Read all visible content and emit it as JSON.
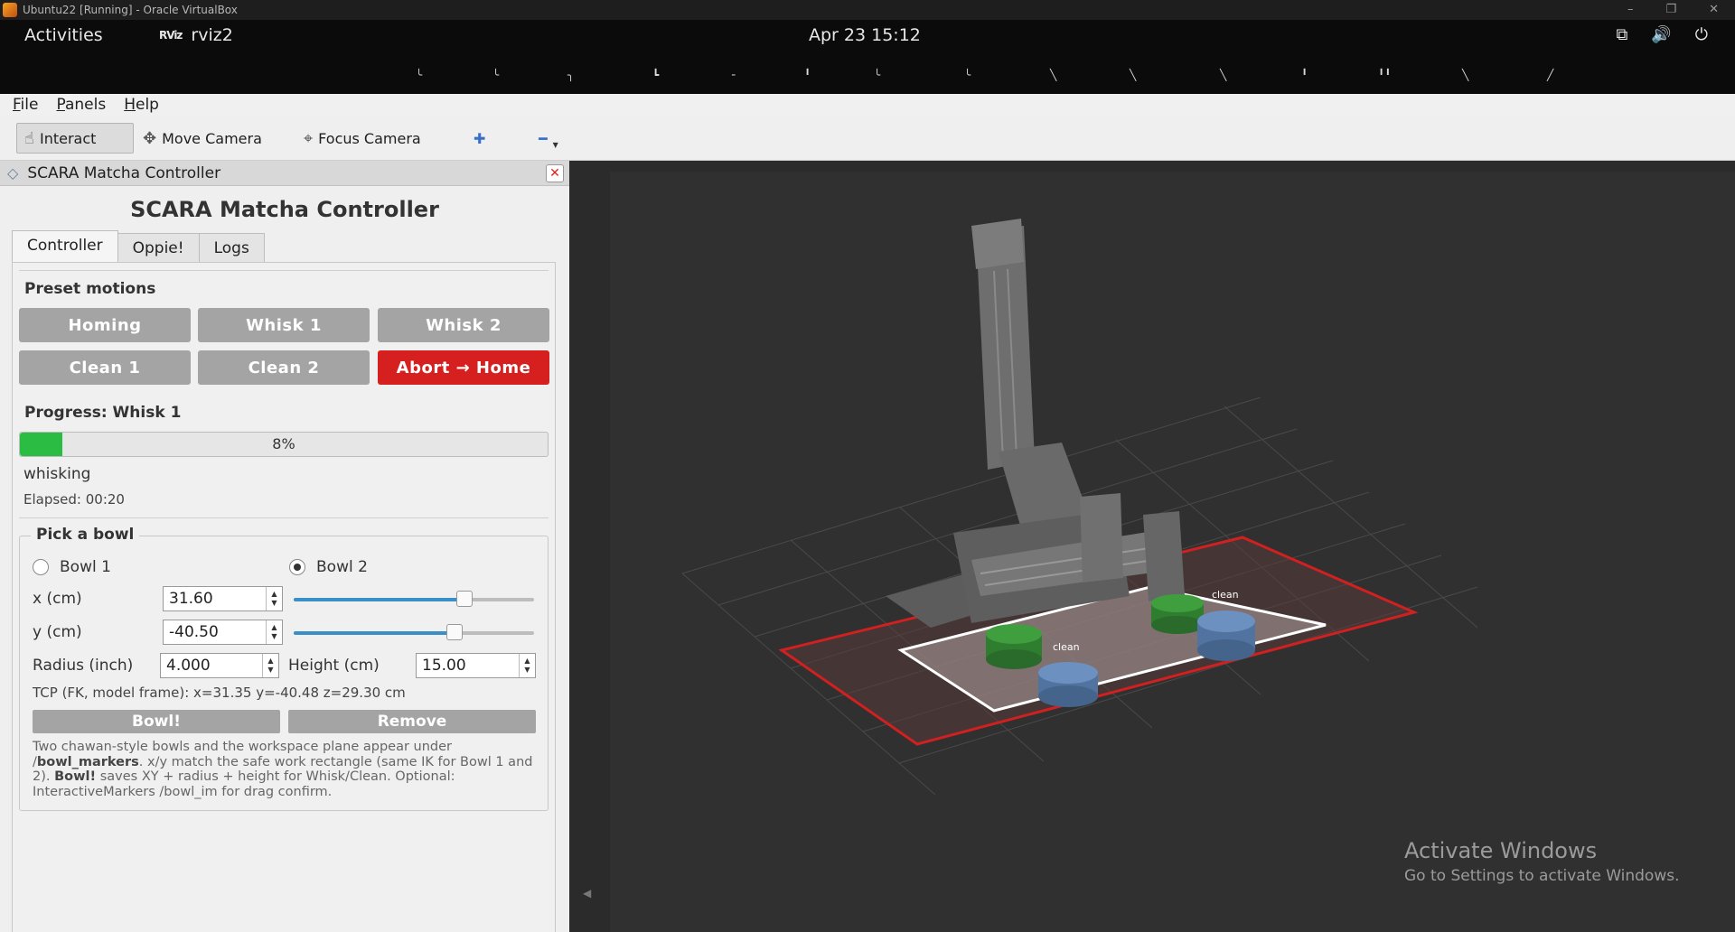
{
  "vbox": {
    "title": "Ubuntu22 [Running] - Oracle VirtualBox",
    "min": "–",
    "restore": "❐",
    "close": "✕"
  },
  "topbar": {
    "activities": "Activities",
    "app_icon": "RViz",
    "app_name": "rviz2",
    "clock": "Apr 23  15:12",
    "icons": [
      "network-icon",
      "volume-icon",
      "power-icon"
    ]
  },
  "ticks": [
    "╰",
    "╰",
    "╮",
    "┗",
    "╴",
    "╹",
    "╰",
    "╰",
    "╲",
    "╲",
    "╲",
    "╹",
    "╹╹",
    "╲",
    "╱"
  ],
  "menu": [
    {
      "label": "File",
      "u": "F",
      "rest": "ile"
    },
    {
      "label": "Panels",
      "u": "P",
      "rest": "anels"
    },
    {
      "label": "Help",
      "u": "H",
      "rest": "elp"
    }
  ],
  "toolbar": {
    "interact": "Interact",
    "move_camera": "Move Camera",
    "focus_camera": "Focus Camera",
    "add": "✚",
    "remove": "━"
  },
  "panel": {
    "header": "SCARA Matcha Controller",
    "title": "SCARA Matcha Controller",
    "tabs": [
      "Controller",
      "Oppie!",
      "Logs"
    ],
    "preset_label": "Preset motions",
    "buttons": {
      "homing": "Homing",
      "whisk1": "Whisk 1",
      "whisk2": "Whisk 2",
      "clean1": "Clean 1",
      "clean2": "Clean 2",
      "abort": "Abort → Home"
    },
    "progress_label": "Progress: Whisk 1",
    "progress": {
      "value": 8,
      "text": "8%"
    },
    "status": "whisking",
    "elapsed": "Elapsed: 00:20",
    "bowl": {
      "title": "Pick a bowl",
      "bowl1": "Bowl 1",
      "bowl2": "Bowl 2",
      "selected": "Bowl 2",
      "x_label": "x (cm)",
      "x_value": "31.60",
      "x_slider": 0.71,
      "y_label": "y (cm)",
      "y_value": "-40.50",
      "y_slider": 0.67,
      "radius_label": "Radius (inch)",
      "radius_value": "4.000",
      "height_label": "Height (cm)",
      "height_value": "15.00",
      "tcp": "TCP (FK, model frame):  x=31.35  y=-40.48  z=29.30  cm",
      "bowl_btn": "Bowl!",
      "remove_btn": "Remove"
    },
    "help": {
      "p1": "Two chawan-style bowls and the workspace plane appear under /",
      "b1": "bowl_markers",
      "p2": ". x/y match the safe work rectangle (same IK for Bowl 1 and 2). ",
      "b2": "Bowl!",
      "p3": " saves XY + radius + height for Whisk/Clean. Optional: InteractiveMarkers /bowl_im for drag confirm."
    }
  },
  "viewport": {
    "bowl_label_1": "clean",
    "bowl_label_2": "clean"
  },
  "watermark": {
    "line1": "Activate Windows",
    "line2": "Go to Settings to activate Windows."
  },
  "colors": {
    "progress": "#2bbd43",
    "abort": "#d62020",
    "slider": "#3a8fc9"
  }
}
